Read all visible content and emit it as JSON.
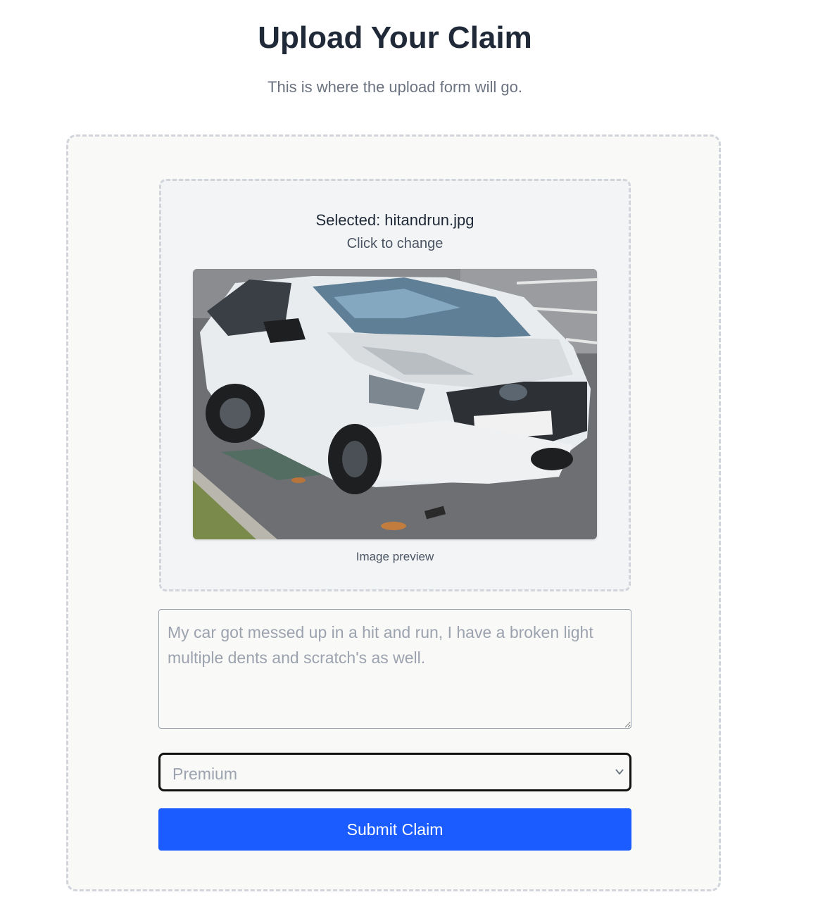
{
  "header": {
    "title": "Upload Your Claim",
    "subtitle": "This is where the upload form will go."
  },
  "upload": {
    "selected_label": "Selected: hitandrun.jpg",
    "change_hint": "Click to change",
    "preview_caption": "Image preview",
    "preview_subject": "damaged white car photo"
  },
  "description": {
    "value": "My car got messed up in a hit and run, I have a broken light multiple dents and scratch's as well."
  },
  "plan_select": {
    "selected": "Premium"
  },
  "submit": {
    "label": "Submit Claim"
  },
  "colors": {
    "primary_button": "#1a5cff",
    "heading": "#1f2937",
    "muted_text": "#6b7280"
  }
}
